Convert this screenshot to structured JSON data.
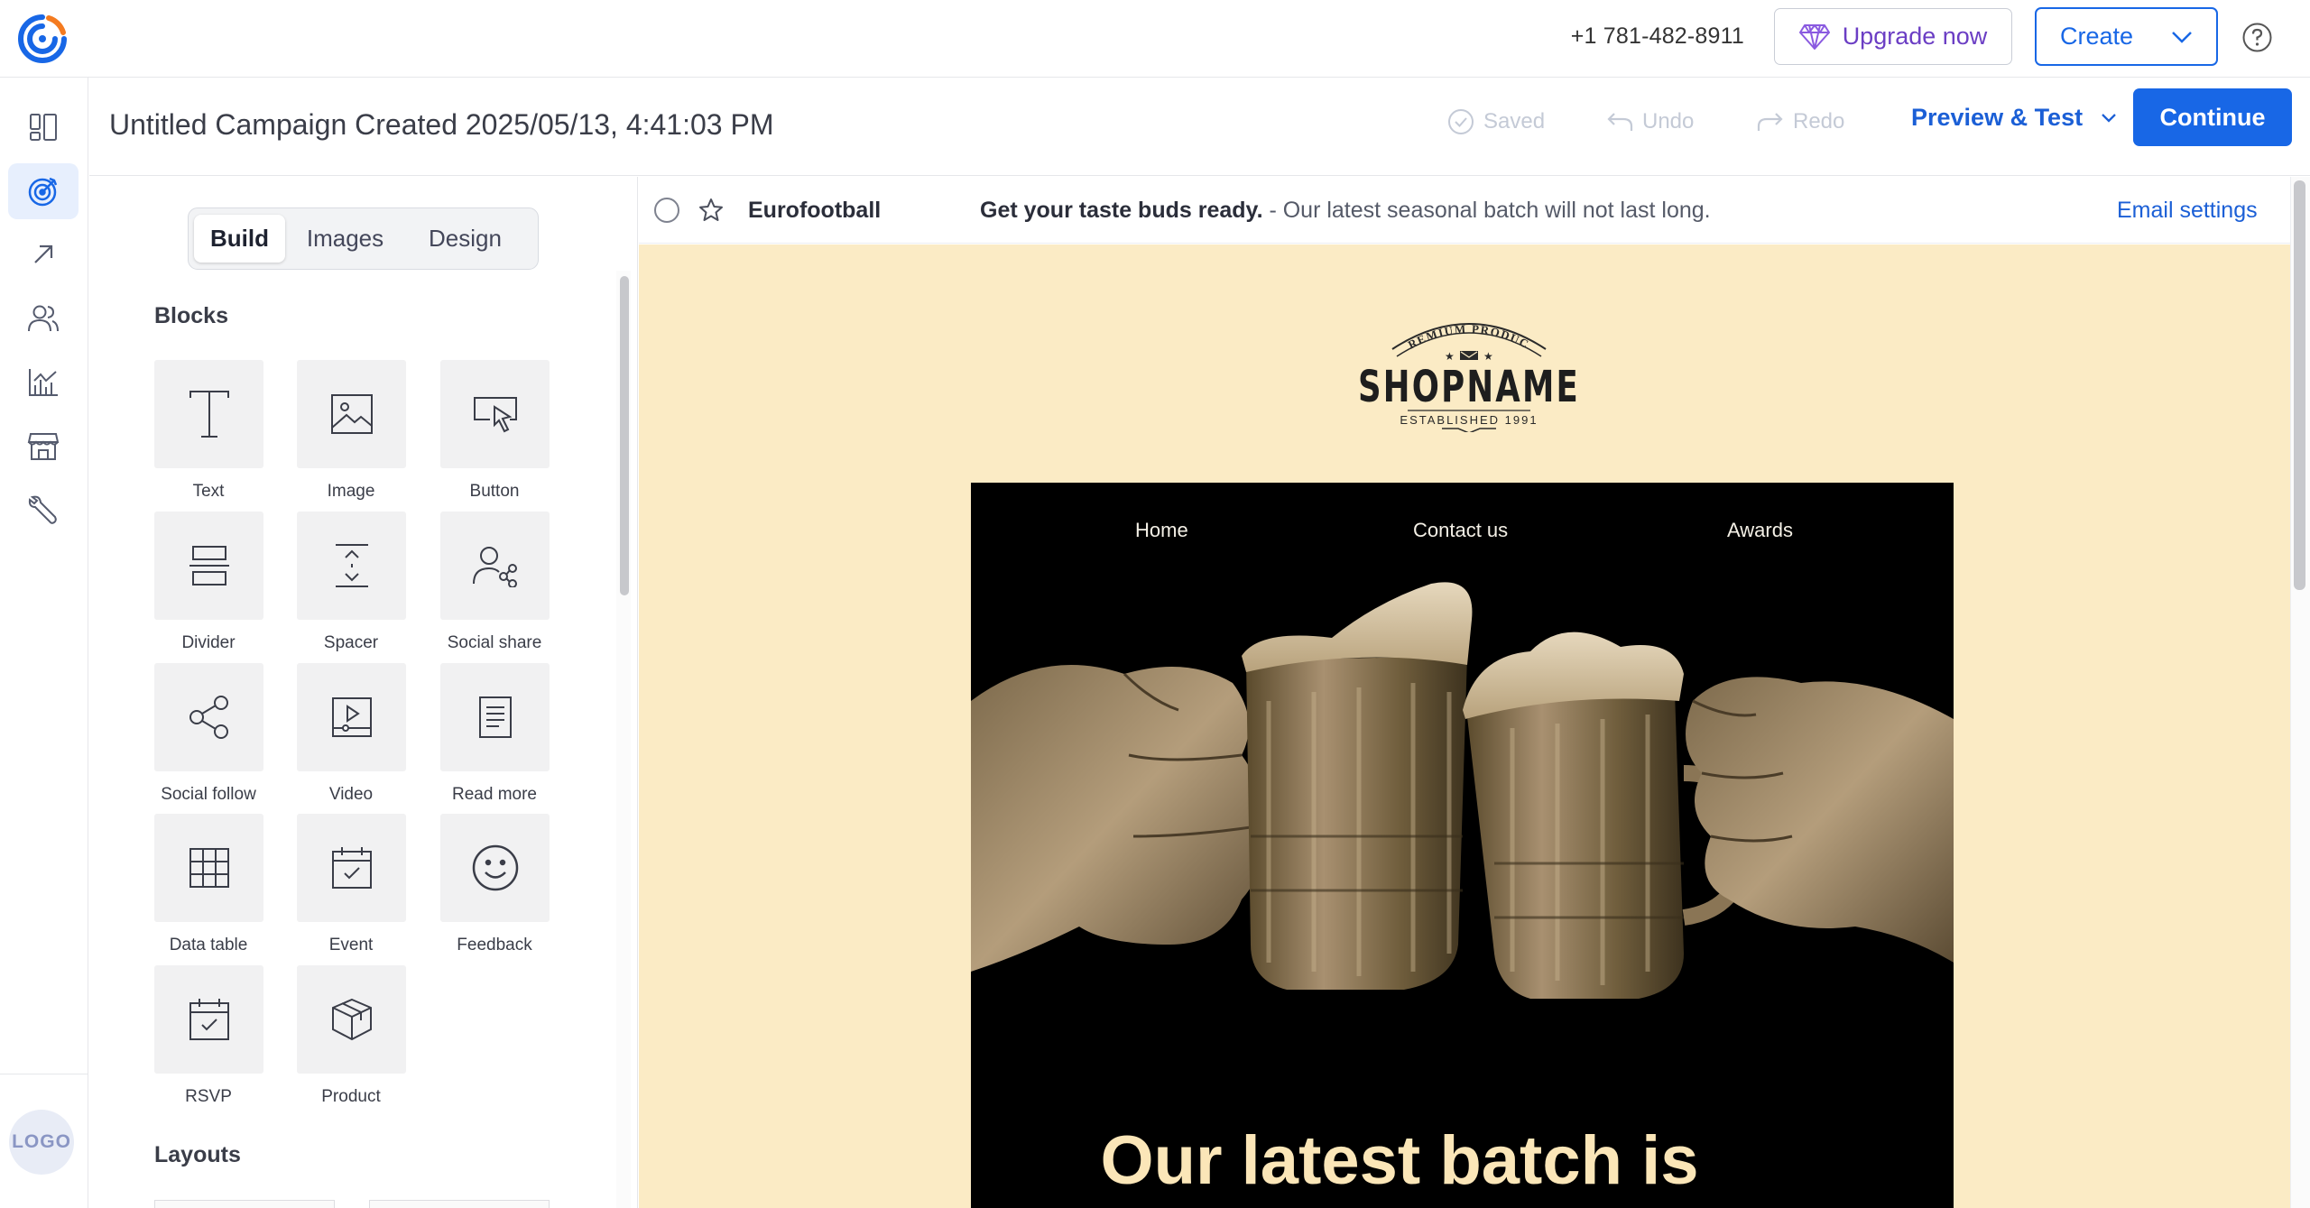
{
  "header": {
    "phone": "+1 781-482-8911",
    "upgrade_label": "Upgrade now",
    "create_label": "Create",
    "help_icon": "question-circle-icon",
    "accent_color": "#1867e6",
    "upgrade_color": "#6b3ec4"
  },
  "rail": {
    "items": [
      "dashboard-icon",
      "campaigns-icon",
      "growth-icon",
      "contacts-icon",
      "reporting-icon",
      "store-icon",
      "tools-icon"
    ],
    "active_index": 1,
    "logo_label": "LOGO"
  },
  "campaign": {
    "title": "Untitled Campaign Created 2025/05/13, 4:41:03 PM",
    "saved_label": "Saved",
    "undo_label": "Undo",
    "redo_label": "Redo",
    "preview_label": "Preview & Test",
    "continue_label": "Continue"
  },
  "panel": {
    "tabs": [
      "Build",
      "Images",
      "Design"
    ],
    "active_tab": "Build",
    "blocks_title": "Blocks",
    "layouts_title": "Layouts",
    "blocks": [
      {
        "label": "Text",
        "icon": "text-icon"
      },
      {
        "label": "Image",
        "icon": "image-icon"
      },
      {
        "label": "Button",
        "icon": "button-icon"
      },
      {
        "label": "Divider",
        "icon": "divider-icon"
      },
      {
        "label": "Spacer",
        "icon": "spacer-icon"
      },
      {
        "label": "Social share",
        "icon": "social-share-icon"
      },
      {
        "label": "Social follow",
        "icon": "social-follow-icon"
      },
      {
        "label": "Video",
        "icon": "video-icon"
      },
      {
        "label": "Read more",
        "icon": "read-more-icon"
      },
      {
        "label": "Data table",
        "icon": "data-table-icon"
      },
      {
        "label": "Event",
        "icon": "event-icon"
      },
      {
        "label": "Feedback",
        "icon": "feedback-icon"
      },
      {
        "label": "RSVP",
        "icon": "rsvp-icon"
      },
      {
        "label": "Product",
        "icon": "product-icon"
      }
    ]
  },
  "email": {
    "sender": "Eurofootball",
    "subject_bold": "Get your taste buds ready.",
    "subject_rest": " - Our latest seasonal batch will not last long.",
    "settings_label": "Email settings",
    "shop_logo": {
      "badge_text": "PREMIUM PRODUCT",
      "name": "SHOPNAME",
      "established": "ESTABLISHED 1991"
    },
    "nav": [
      "Home",
      "Contact us",
      "Awards"
    ],
    "headline": "Our latest batch is",
    "background_color": "#fbebc5",
    "headline_color": "#fbe6b8"
  }
}
